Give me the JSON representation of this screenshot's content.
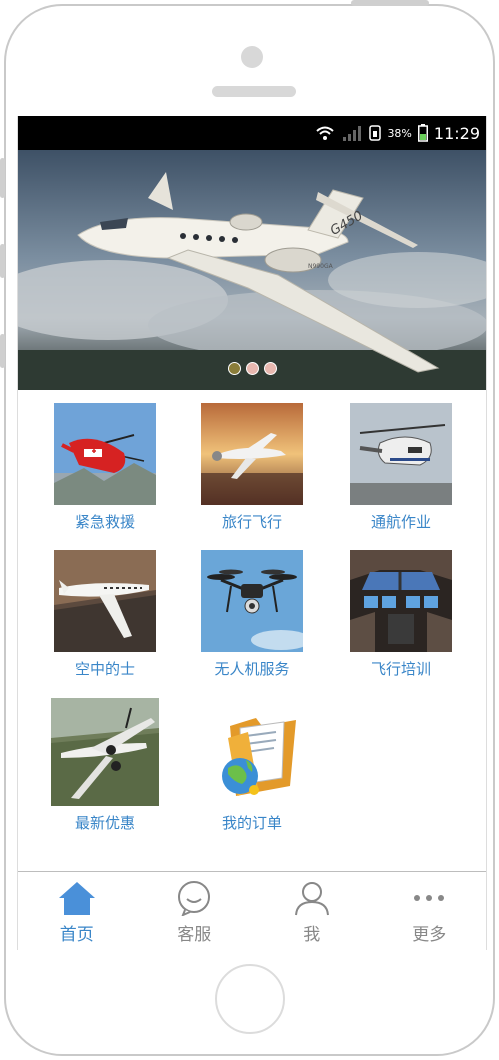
{
  "status": {
    "battery": "38%",
    "time": "11:29"
  },
  "banner": {
    "tail_text": "G450",
    "reg_text": "N990GA",
    "dots": 3,
    "active_dot": 0
  },
  "services": [
    {
      "label": "紧急救援",
      "icon": "rescue-helicopter-icon"
    },
    {
      "label": "旅行飞行",
      "icon": "travel-plane-icon"
    },
    {
      "label": "通航作业",
      "icon": "utility-helicopter-icon"
    },
    {
      "label": "空中的士",
      "icon": "air-taxi-jet-icon"
    },
    {
      "label": "无人机服务",
      "icon": "drone-icon"
    },
    {
      "label": "飞行培训",
      "icon": "cockpit-icon"
    },
    {
      "label": "最新优惠",
      "icon": "turboprop-plane-icon"
    },
    {
      "label": "我的订单",
      "icon": "folder-globe-icon"
    }
  ],
  "tabs": [
    {
      "label": "首页",
      "icon": "home-icon",
      "active": true
    },
    {
      "label": "客服",
      "icon": "chat-bubble-icon",
      "active": false
    },
    {
      "label": "我",
      "icon": "user-icon",
      "active": false
    },
    {
      "label": "更多",
      "icon": "more-dots-icon",
      "active": false
    }
  ],
  "colors": {
    "accent": "#3a86c8",
    "statusbar": "#000000",
    "tab_inactive": "#888888"
  }
}
